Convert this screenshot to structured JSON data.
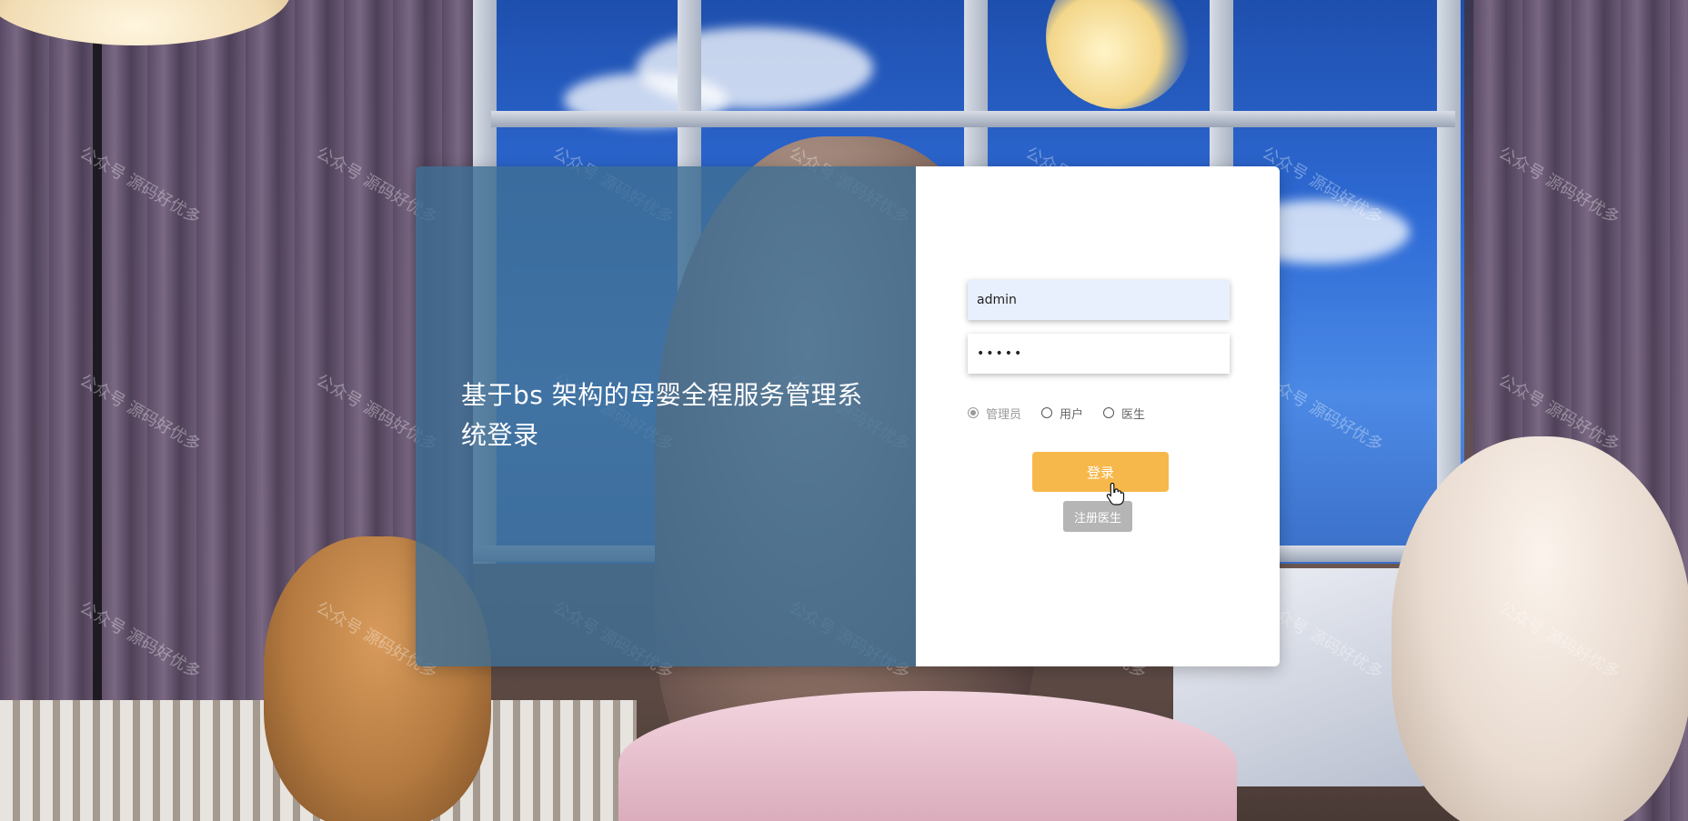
{
  "login": {
    "title": "基于bs 架构的母婴全程服务管理系统登录",
    "username_value": "admin",
    "password_value": "•••••",
    "roles": [
      {
        "label": "管理员",
        "checked": true
      },
      {
        "label": "用户",
        "checked": false
      },
      {
        "label": "医生",
        "checked": false
      }
    ],
    "login_label": "登录",
    "register_label": "注册医生"
  },
  "watermark_text": "公众号 源码好优多",
  "colors": {
    "login_button": "#f7b84b",
    "register_button": "#b5b5b5",
    "left_panel": "#3e6e94"
  },
  "icons": {
    "cursor": "hand-pointer-icon"
  }
}
